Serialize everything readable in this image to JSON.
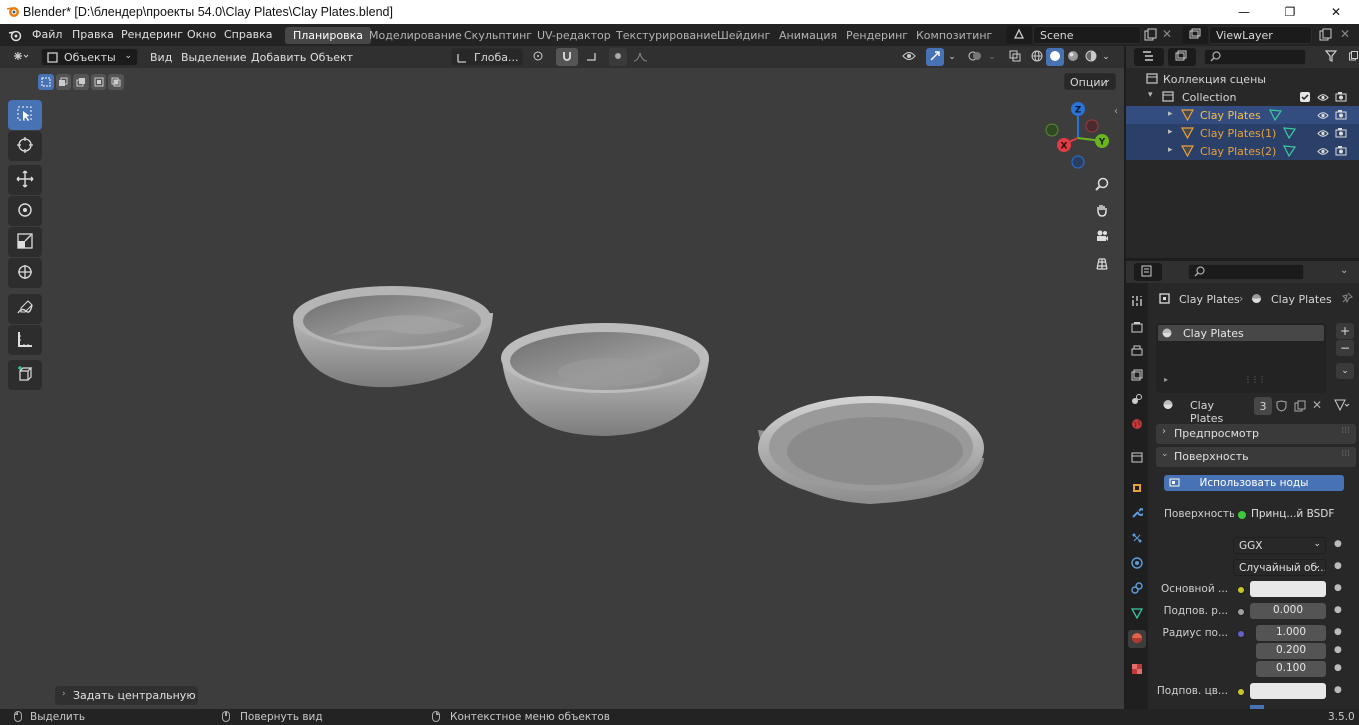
{
  "window": {
    "title": "Blender* [D:\\блендер\\проекты 54.0\\Clay Plates\\Clay Plates.blend]",
    "minimize": "—",
    "maximize": "❐",
    "close": "✕"
  },
  "menu": [
    "Файл",
    "Правка",
    "Рендеринг",
    "Окно",
    "Справка"
  ],
  "workspaces": [
    "Планировка",
    "Моделирование",
    "Скульптинг",
    "UV-редактор",
    "Текстурирование",
    "Шейдинг",
    "Анимация",
    "Рендеринг",
    "Композитинг"
  ],
  "active_workspace": "Планировка",
  "scene_name": "Scene",
  "view_layer": "ViewLayer",
  "viewport_header": {
    "mode": "Объекты",
    "menus": [
      "Вид",
      "Выделение",
      "Добавить",
      "Объект"
    ],
    "orientation": "Глоба...",
    "options": "Опции"
  },
  "viewport": {
    "last_operator": "Задать центральную точк",
    "gizmo_axes": [
      "Z",
      "X",
      "Y"
    ]
  },
  "outliner": {
    "scene_collection": "Коллекция сцены",
    "collection": "Collection",
    "objects": [
      "Clay Plates",
      "Clay Plates(1)",
      "Clay Plates(2)"
    ]
  },
  "properties": {
    "breadcrumb_object": "Clay Plates",
    "breadcrumb_material": "Clay Plates",
    "material_slot": "Clay Plates",
    "material_name": "Clay Plates",
    "material_users": "3",
    "panel_preview": "Предпросмотр",
    "panel_surface": "Поверхность",
    "use_nodes_button": "Использовать ноды",
    "surface_label": "Поверхность",
    "surface_value": "Принц...й BSDF",
    "distribution": "GGX",
    "subsurface_method": "Случайный об...",
    "base_color_label": "Основной ...",
    "base_color": "#e8e8e8",
    "subsurface_label": "Подпов. р...",
    "subsurface_value": "0.000",
    "radius_label": "Радиус по...",
    "radius_values": [
      "1.000",
      "0.200",
      "0.100"
    ],
    "subsurface_color_label": "Подпов. цв...",
    "subsurface_color": "#e8e8e8"
  },
  "statusbar": {
    "select": "Выделить",
    "rotate": "Повернуть вид",
    "context": "Контекстное меню объектов",
    "version": "3.5.0"
  },
  "colors": {
    "accent": "#4772b3",
    "object_orange": "#e8a03c",
    "mesh_green": "#3cc8a0",
    "viewport_bg": "#3d3d3d"
  }
}
